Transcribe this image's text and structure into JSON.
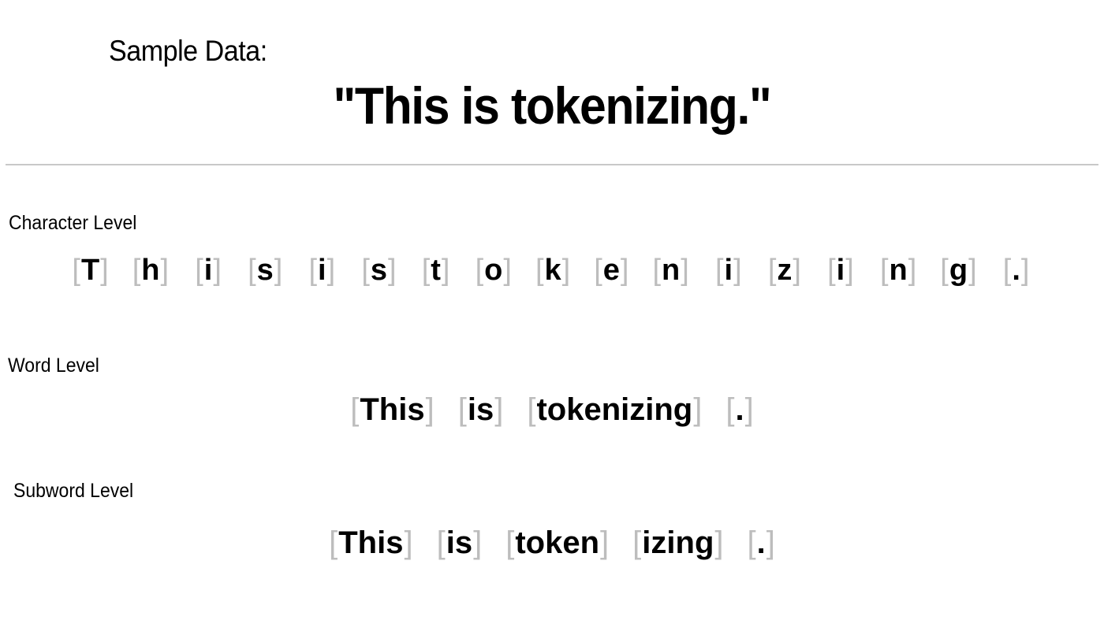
{
  "header": {
    "label": "Sample Data:",
    "sample_text": "\"This is tokenizing.\""
  },
  "bracket_color": "#bdbdbd",
  "divider_color": "#c8c8c8",
  "brackets": {
    "open": "[",
    "close": "]"
  },
  "levels": [
    {
      "label": "Character Level",
      "tokens": [
        "T",
        "h",
        "i",
        "s",
        "i",
        "s",
        "t",
        "o",
        "k",
        "e",
        "n",
        "i",
        "z",
        "i",
        "n",
        "g",
        "."
      ]
    },
    {
      "label": "Word Level",
      "tokens": [
        "This",
        "is",
        "tokenizing",
        "."
      ]
    },
    {
      "label": "Subword Level",
      "tokens": [
        "This",
        "is",
        "token",
        "izing",
        "."
      ]
    }
  ]
}
